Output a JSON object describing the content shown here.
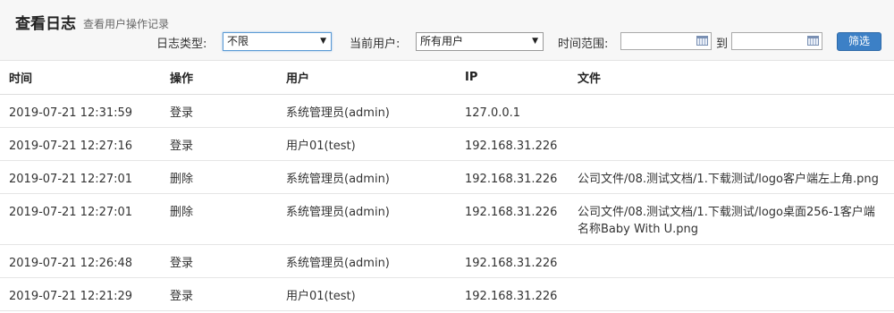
{
  "header": {
    "title": "查看日志",
    "subtitle": "查看用户操作记录"
  },
  "filters": {
    "log_type_label": "日志类型:",
    "log_type_value": "不限",
    "current_user_label": "当前用户:",
    "current_user_value": "所有用户",
    "time_range_label": "时间范围:",
    "to_label": "到",
    "start_date_value": "",
    "end_date_value": "",
    "filter_button": "筛选"
  },
  "table": {
    "columns": [
      "时间",
      "操作",
      "用户",
      "IP",
      "文件"
    ],
    "rows": [
      {
        "time": "2019-07-21 12:31:59",
        "action": "登录",
        "user": "系统管理员(admin)",
        "ip": "127.0.0.1",
        "file": ""
      },
      {
        "time": "2019-07-21 12:27:16",
        "action": "登录",
        "user": "用户01(test)",
        "ip": "192.168.31.226",
        "file": ""
      },
      {
        "time": "2019-07-21 12:27:01",
        "action": "删除",
        "user": "系统管理员(admin)",
        "ip": "192.168.31.226",
        "file": "公司文件/08.测试文档/1.下载测试/logo客户端左上角.png"
      },
      {
        "time": "2019-07-21 12:27:01",
        "action": "删除",
        "user": "系统管理员(admin)",
        "ip": "192.168.31.226",
        "file": "公司文件/08.测试文档/1.下载测试/logo桌面256-1客户端名称Baby With U.png"
      },
      {
        "time": "2019-07-21 12:26:48",
        "action": "登录",
        "user": "系统管理员(admin)",
        "ip": "192.168.31.226",
        "file": ""
      },
      {
        "time": "2019-07-21 12:21:29",
        "action": "登录",
        "user": "用户01(test)",
        "ip": "192.168.31.226",
        "file": ""
      }
    ]
  },
  "colors": {
    "header_bg": "#f7f7f7",
    "filter_button_bg": "#3c80c6"
  },
  "icons": {
    "select_arrow": "chevron-down-icon",
    "date_picker": "calendar-icon"
  }
}
